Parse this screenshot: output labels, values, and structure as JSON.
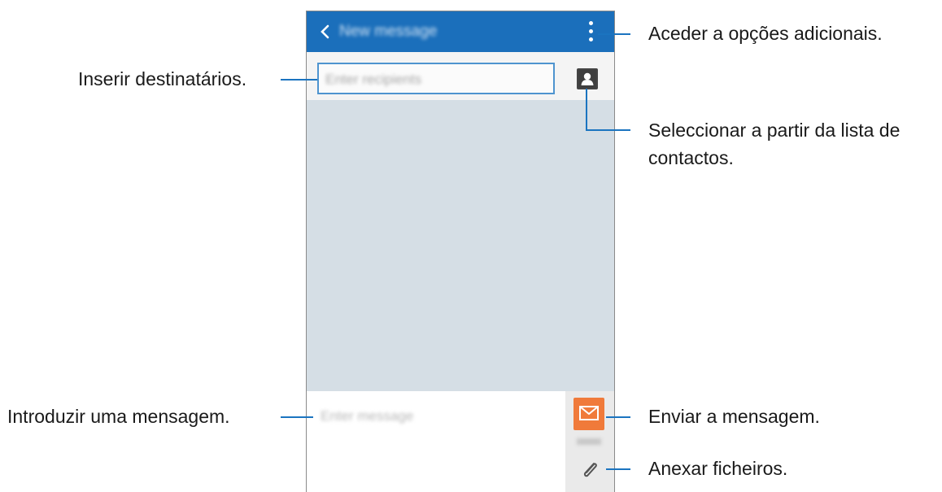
{
  "screen": {
    "title": "New message",
    "recipient_placeholder": "Enter recipients",
    "message_placeholder": "Enter message"
  },
  "callouts": {
    "more_options": "Aceder a opções adicionais.",
    "recipients": "Inserir destinatários.",
    "contacts": [
      "Seleccionar a partir da lista de",
      "contactos."
    ],
    "message": "Introduzir uma mensagem.",
    "send": "Enviar a mensagem.",
    "attach": "Anexar ficheiros."
  },
  "colors": {
    "appbar": "#1b6fbb",
    "leader": "#1b74c0",
    "send_button": "#f07a3a",
    "background": "#d5dee5"
  },
  "icons": [
    "back-icon",
    "more-options-icon",
    "contact-icon",
    "send-message-icon",
    "paperclip-icon"
  ]
}
